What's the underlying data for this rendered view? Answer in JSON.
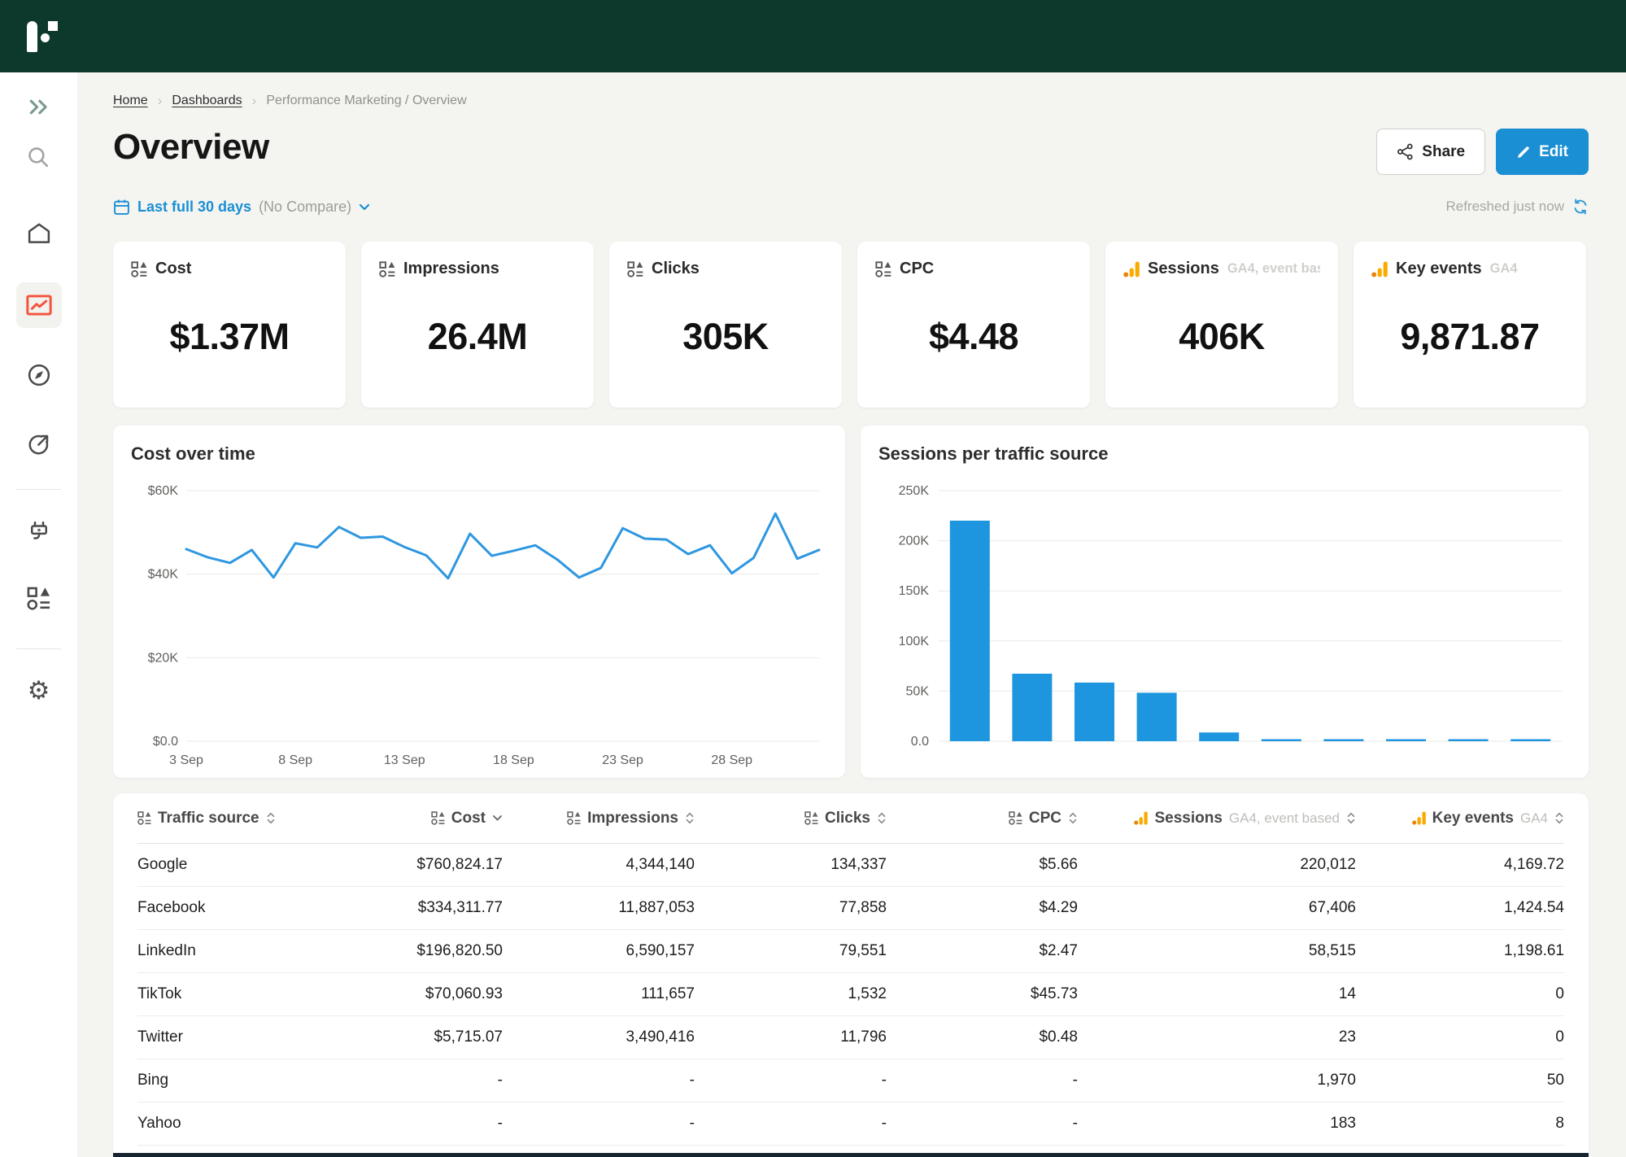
{
  "colors": {
    "topbar_green": "#0c392b",
    "accent_blue": "#1b8fd3",
    "line_chart_blue": "#2e97e0",
    "bar_chart_blue": "#1e96df",
    "active_icon_red": "#f4523b",
    "ga_orange": "#f9ab00",
    "ga_orange_dark": "#e8840c",
    "page_background": "#f4f4f1"
  },
  "sidebar": {
    "items": [
      {
        "id": "expand",
        "icon": "double-chevron-right-icon"
      },
      {
        "id": "search",
        "icon": "search-icon"
      },
      {
        "id": "home",
        "icon": "home-icon"
      },
      {
        "id": "dashboards",
        "icon": "line-chart-icon",
        "active": true
      },
      {
        "id": "explore",
        "icon": "compass-icon"
      },
      {
        "id": "export",
        "icon": "arrow-up-right-circle-icon"
      },
      {
        "id": "connectors",
        "icon": "plug-icon"
      },
      {
        "id": "data",
        "icon": "shapes-icon"
      },
      {
        "id": "settings",
        "icon": "gear-icon"
      }
    ]
  },
  "breadcrumb": [
    {
      "label": "Home"
    },
    {
      "label": "Dashboards"
    },
    {
      "label": "Performance Marketing / Overview"
    }
  ],
  "header": {
    "title": "Overview",
    "share_button": "Share",
    "edit_button": "Edit"
  },
  "toolbar": {
    "date_range": "Last full 30 days",
    "compare": "(No Compare)",
    "refreshed": "Refreshed just now"
  },
  "kpis": [
    {
      "icon": "shapes",
      "label": "Cost",
      "badge": "",
      "value": "$1.37M"
    },
    {
      "icon": "shapes",
      "label": "Impressions",
      "badge": "",
      "value": "26.4M"
    },
    {
      "icon": "shapes",
      "label": "Clicks",
      "badge": "",
      "value": "305K"
    },
    {
      "icon": "shapes",
      "label": "CPC",
      "badge": "",
      "value": "$4.48"
    },
    {
      "icon": "ga",
      "label": "Sessions",
      "badge": "GA4, event bas",
      "value": "406K"
    },
    {
      "icon": "ga",
      "label": "Key events",
      "badge": "GA4",
      "value": "9,871.87"
    }
  ],
  "chart_data": [
    {
      "type": "line",
      "title": "Cost over time",
      "series": [
        {
          "name": "Cost",
          "values": [
            46000,
            44000,
            42700,
            45800,
            39200,
            47400,
            46400,
            51300,
            48700,
            49000,
            46500,
            44500,
            39000,
            49700,
            44400,
            45600,
            46900,
            43500,
            39200,
            41500,
            51000,
            48500,
            48300,
            44800,
            46900,
            40200,
            43900,
            54500,
            43700,
            45800
          ]
        }
      ],
      "x_range": "3 Sep - 2 Oct",
      "xtick_labels": [
        "3 Sep",
        "8 Sep",
        "13 Sep",
        "18 Sep",
        "23 Sep",
        "28 Sep"
      ],
      "xtick_indices": [
        0,
        5,
        10,
        15,
        20,
        25
      ],
      "ylim": [
        0,
        60000
      ],
      "ytick_values": [
        0,
        20000,
        40000,
        60000
      ],
      "ytick_labels": [
        "$0.0",
        "$20K",
        "$40K",
        "$60K"
      ],
      "grid": true,
      "legend": "none",
      "line_color": "#2e97e0"
    },
    {
      "type": "bar",
      "title": "Sessions per traffic source",
      "categories": [
        "",
        "",
        "",
        "",
        "",
        "",
        "",
        "",
        "",
        ""
      ],
      "values": [
        220012,
        67406,
        58515,
        48400,
        8800,
        2000,
        2000,
        2000,
        2000,
        2000
      ],
      "ylim": [
        0,
        250000
      ],
      "ytick_values": [
        0,
        50000,
        100000,
        150000,
        200000,
        250000
      ],
      "ytick_labels": [
        "0.0",
        "50K",
        "100K",
        "150K",
        "200K",
        "250K"
      ],
      "grid": true,
      "legend": "none",
      "bar_color": "#1e96df"
    }
  ],
  "table": {
    "columns": [
      {
        "label": "Traffic source",
        "badge": "",
        "icon": "shapes",
        "sort": "none",
        "align": "left"
      },
      {
        "label": "Cost",
        "badge": "",
        "icon": "shapes",
        "sort": "desc",
        "align": "right"
      },
      {
        "label": "Impressions",
        "badge": "",
        "icon": "shapes",
        "sort": "none",
        "align": "right"
      },
      {
        "label": "Clicks",
        "badge": "",
        "icon": "shapes",
        "sort": "none",
        "align": "right"
      },
      {
        "label": "CPC",
        "badge": "",
        "icon": "shapes",
        "sort": "none",
        "align": "right"
      },
      {
        "label": "Sessions",
        "badge": "GA4, event based",
        "icon": "ga",
        "sort": "none",
        "align": "right"
      },
      {
        "label": "Key events",
        "badge": "GA4",
        "icon": "ga",
        "sort": "none",
        "align": "right"
      }
    ],
    "rows": [
      [
        "Google",
        "$760,824.17",
        "4,344,140",
        "134,337",
        "$5.66",
        "220,012",
        "4,169.72"
      ],
      [
        "Facebook",
        "$334,311.77",
        "11,887,053",
        "77,858",
        "$4.29",
        "67,406",
        "1,424.54"
      ],
      [
        "LinkedIn",
        "$196,820.50",
        "6,590,157",
        "79,551",
        "$2.47",
        "58,515",
        "1,198.61"
      ],
      [
        "TikTok",
        "$70,060.93",
        "111,657",
        "1,532",
        "$45.73",
        "14",
        "0"
      ],
      [
        "Twitter",
        "$5,715.07",
        "3,490,416",
        "11,796",
        "$0.48",
        "23",
        "0"
      ],
      [
        "Bing",
        "-",
        "-",
        "-",
        "-",
        "1,970",
        "50"
      ],
      [
        "Yahoo",
        "-",
        "-",
        "-",
        "-",
        "183",
        "8"
      ]
    ]
  }
}
